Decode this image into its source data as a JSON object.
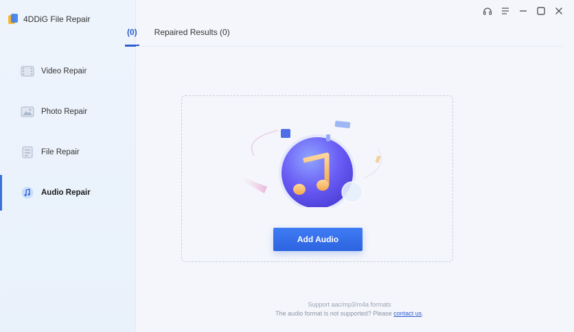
{
  "app": {
    "title": "4DDiG File Repair"
  },
  "sidebar": {
    "items": [
      {
        "label": "Video Repair"
      },
      {
        "label": "Photo Repair"
      },
      {
        "label": "File Repair"
      },
      {
        "label": "Audio Repair",
        "active": true
      }
    ]
  },
  "tabs": [
    {
      "label": "(0)",
      "active": true
    },
    {
      "label": "Repaired Results (0)"
    }
  ],
  "main": {
    "add_button_label": "Add Audio",
    "support_text": "Support aac/mp3/m4a formats",
    "unsupported_prefix": "The audio format is not supported? Please ",
    "contact_link": "contact us",
    "unsupported_suffix": "."
  },
  "icons": [
    "headset-icon",
    "menu-icon",
    "minimize-icon",
    "maximize-icon",
    "close-icon",
    "video-icon",
    "photo-icon",
    "file-icon",
    "music-note-icon"
  ],
  "colors": {
    "accent": "#2d63e0",
    "sidebar_bg": "#eef4fc",
    "page_bg": "#f4f6fb"
  }
}
